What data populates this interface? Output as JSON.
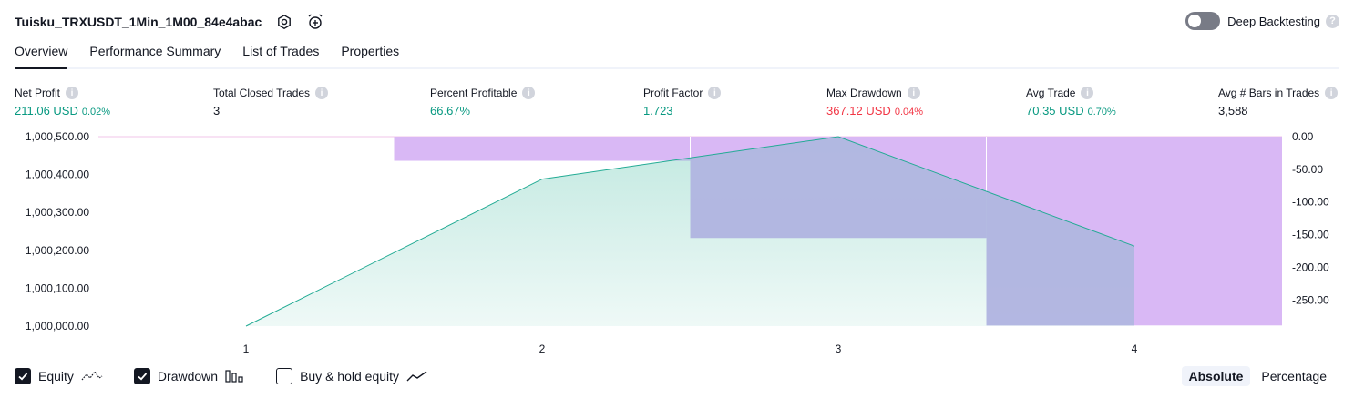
{
  "header": {
    "strategy_name": "Tuisku_TRXUSDT_1Min_1M00_84e4abac",
    "settings_icon": "gear-icon",
    "alert_icon": "alarm-plus-icon",
    "deep_backtesting_label": "Deep Backtesting",
    "deep_backtesting_enabled": false,
    "help_glyph": "?"
  },
  "tabs": [
    {
      "label": "Overview",
      "active": true
    },
    {
      "label": "Performance Summary",
      "active": false
    },
    {
      "label": "List of Trades",
      "active": false
    },
    {
      "label": "Properties",
      "active": false
    }
  ],
  "metrics": {
    "net_profit": {
      "label": "Net Profit",
      "value": "211.06 USD",
      "pct": "0.02%"
    },
    "total_closed_trades": {
      "label": "Total Closed Trades",
      "value": "3"
    },
    "percent_profitable": {
      "label": "Percent Profitable",
      "value": "66.67%"
    },
    "profit_factor": {
      "label": "Profit Factor",
      "value": "1.723"
    },
    "max_drawdown": {
      "label": "Max Drawdown",
      "value": "367.12 USD",
      "pct": "0.04%"
    },
    "avg_trade": {
      "label": "Avg Trade",
      "value": "70.35 USD",
      "pct": "0.70%"
    },
    "avg_bars": {
      "label": "Avg # Bars in Trades",
      "value": "3,588"
    },
    "info_glyph": "i"
  },
  "colors": {
    "equity_line": "#22ab94",
    "equity_fill": "#b2e6dc",
    "drawdown_fill": "#e1bee7",
    "drawdown_bar": "#d9b8f5",
    "overlap": "#b1b6e0",
    "profit": "#089981",
    "loss": "#f23645"
  },
  "chart_data": {
    "type": "area",
    "x_ticks": [
      "1",
      "2",
      "3",
      "4"
    ],
    "left_axis_ticks": [
      "1,000,500.00",
      "1,000,400.00",
      "1,000,300.00",
      "1,000,200.00",
      "1,000,100.00",
      "1,000,000.00"
    ],
    "right_axis_ticks": [
      "0.00",
      "-50.00",
      "-100.00",
      "-150.00",
      "-200.00",
      "-250.00"
    ],
    "ylim_left": [
      1000000,
      1000500
    ],
    "ylim_right": [
      -290,
      0
    ],
    "series": [
      {
        "name": "Equity",
        "x": [
          1,
          2,
          3,
          4
        ],
        "values": [
          1000000.0,
          1000388.0,
          1000500.0,
          1000211.06
        ]
      },
      {
        "name": "Drawdown",
        "x": [
          1.5,
          2.5,
          3.5
        ],
        "x_end": [
          2.5,
          3.5,
          4.5
        ],
        "values": [
          -37.0,
          -155.0,
          -289.0
        ]
      }
    ]
  },
  "legend": {
    "items": [
      {
        "label": "Equity",
        "checked": true,
        "icon": "equity-line-icon"
      },
      {
        "label": "Drawdown",
        "checked": true,
        "icon": "drawdown-bars-icon"
      },
      {
        "label": "Buy & hold equity",
        "checked": false,
        "icon": "buy-hold-line-icon"
      }
    ],
    "modes": [
      {
        "label": "Absolute",
        "active": true
      },
      {
        "label": "Percentage",
        "active": false
      }
    ]
  }
}
